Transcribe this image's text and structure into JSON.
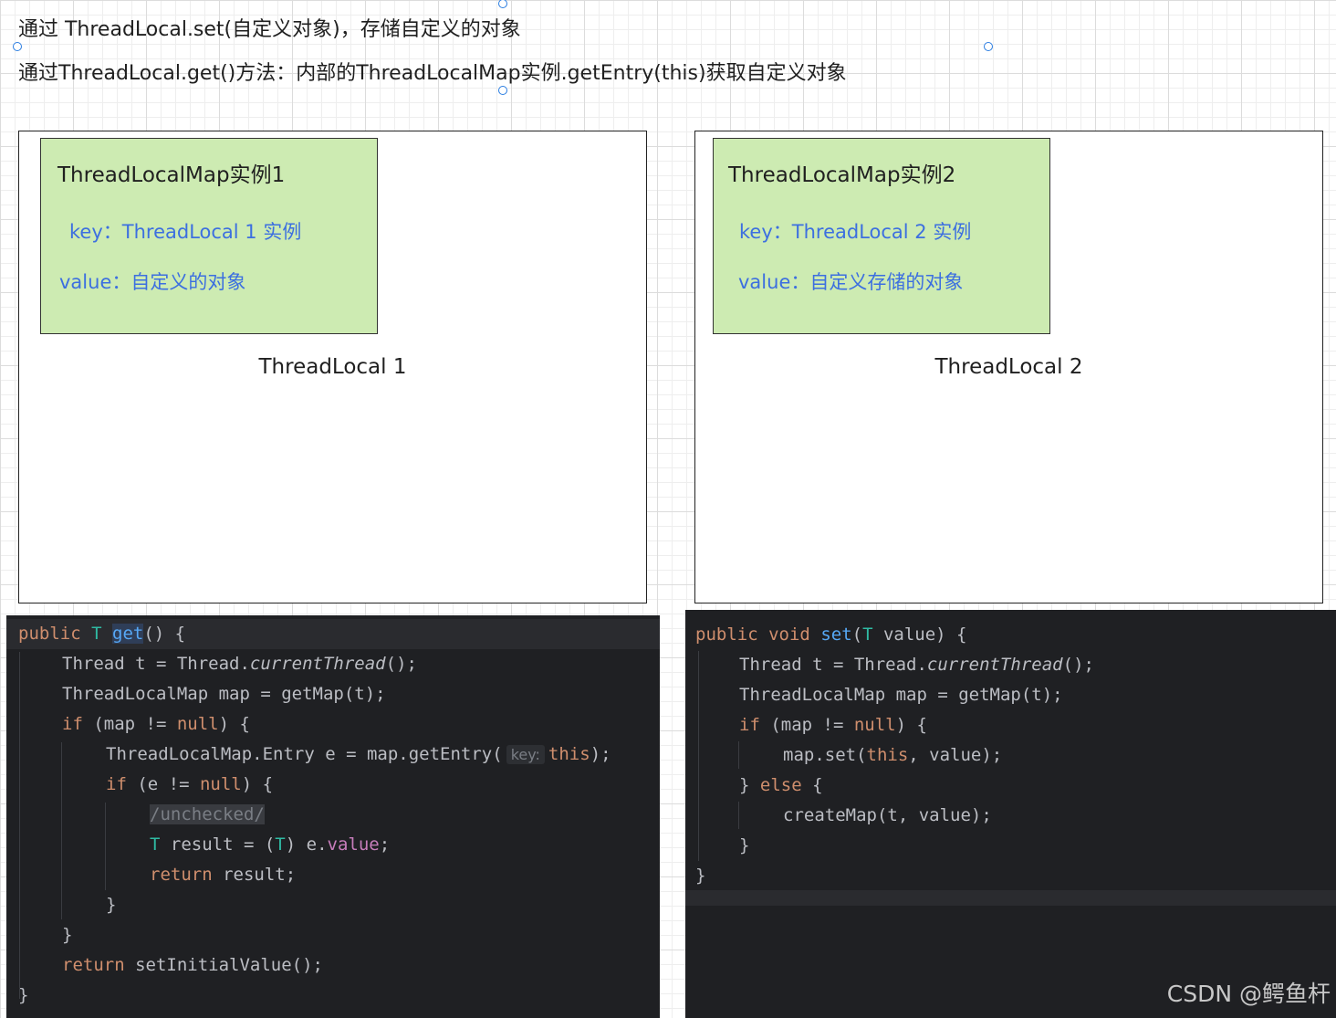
{
  "notes": {
    "line1": "通过 ThreadLocal.set(自定义对象)，存储自定义的对象",
    "line2": "通过ThreadLocal.get()方法：内部的ThreadLocalMap实例.getEntry(this)获取自定义对象"
  },
  "diagram": {
    "threadlocals": [
      {
        "label": "ThreadLocal 1",
        "map": {
          "title": "ThreadLocalMap实例1",
          "key": "key：ThreadLocal 1 实例",
          "value": "value：自定义的对象"
        }
      },
      {
        "label": "ThreadLocal 2",
        "map": {
          "title": "ThreadLocalMap实例2",
          "key": "key：ThreadLocal 2 实例",
          "value": "value：自定义存储的对象"
        }
      }
    ]
  },
  "code": {
    "get": {
      "sig_public": "public",
      "sig_T": "T",
      "sig_name": "get",
      "sig_rest": "() {",
      "l2_a": "Thread t = Thread.",
      "l2_b": "currentThread",
      "l2_c": "();",
      "l3": "ThreadLocalMap map = getMap(t);",
      "l4_kw": "if",
      "l4_a": " (map != ",
      "l4_null": "null",
      "l4_b": ") {",
      "l5_a": "ThreadLocalMap.Entry e = map.getEntry(",
      "l5_hint": "key:",
      "l5_this": "this",
      "l5_b": ");",
      "l6_kw": "if",
      "l6_a": " (e != ",
      "l6_null": "null",
      "l6_b": ") {",
      "l7_comment": "/unchecked/",
      "l8_T": "T",
      "l8_a": " result = (",
      "l8_T2": "T",
      "l8_b": ") e.",
      "l8_field": "value",
      "l8_c": ";",
      "l9_kw": "return",
      "l9_a": " result;",
      "l10": "}",
      "l11": "}",
      "l12_kw": "return",
      "l12_a": " setInitialValue();",
      "l13": "}"
    },
    "set": {
      "sig_public": "public",
      "sig_void": "void",
      "sig_name": "set",
      "sig_open": "(",
      "sig_T": "T",
      "sig_rest": " value) {",
      "l2_a": "Thread t = Thread.",
      "l2_b": "currentThread",
      "l2_c": "();",
      "l3": "ThreadLocalMap map = getMap(t);",
      "l4_kw": "if",
      "l4_a": " (map != ",
      "l4_null": "null",
      "l4_b": ") {",
      "l5_a": "map.set(",
      "l5_this": "this",
      "l5_b": ", value);",
      "l6_a": "} ",
      "l6_kw": "else",
      "l6_b": " {",
      "l7": "createMap(t, value);",
      "l8": "}",
      "l9": "}"
    }
  },
  "watermark": "CSDN @鳄鱼杆"
}
